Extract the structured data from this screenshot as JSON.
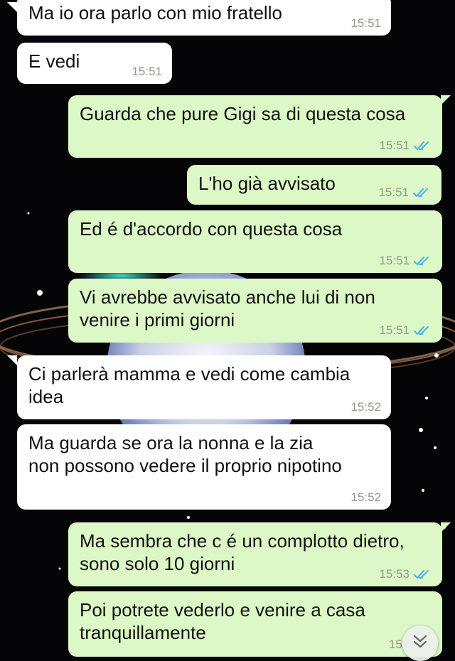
{
  "messages": [
    {
      "direction": "incoming",
      "text": "Ma io ora parlo con mio fratello",
      "time": "15:51",
      "read": false
    },
    {
      "direction": "incoming",
      "text": "E vedi",
      "time": "15:51",
      "read": false
    },
    {
      "direction": "outgoing",
      "text": "Guarda che pure Gigi sa di questa cosa",
      "time": "15:51",
      "read": true
    },
    {
      "direction": "outgoing",
      "text": "L'ho già avvisato",
      "time": "15:51",
      "read": true
    },
    {
      "direction": "outgoing",
      "text": "Ed é d'accordo con questa cosa",
      "time": "15:51",
      "read": true
    },
    {
      "direction": "outgoing",
      "text": "Vi avrebbe avvisato anche lui di non\nvenire i primi giorni",
      "time": "15:51",
      "read": true
    },
    {
      "direction": "incoming",
      "text": "Ci parlerà mamma e vedi come cambia\nidea",
      "time": "15:52",
      "read": false
    },
    {
      "direction": "incoming",
      "text": "Ma guarda se ora la nonna e la zia\nnon possono vedere il proprio nipotino",
      "time": "15:52",
      "read": false
    },
    {
      "direction": "outgoing",
      "text": "Ma sembra che c é un complotto dietro,\nsono solo 10 giorni",
      "time": "15:53",
      "read": true
    },
    {
      "direction": "outgoing",
      "text": "Poi potrete vederlo e venire a casa\ntranquillamente",
      "time": "15:5",
      "read": true
    }
  ],
  "colors": {
    "incoming_bubble": "#ffffff",
    "outgoing_bubble": "#dcf8c6",
    "read_ticks": "#4fb6ec",
    "timestamp": "#8f9a8f"
  },
  "icons": {
    "read_receipt": "double-check-icon",
    "scroll_down": "double-chevron-down-icon"
  }
}
